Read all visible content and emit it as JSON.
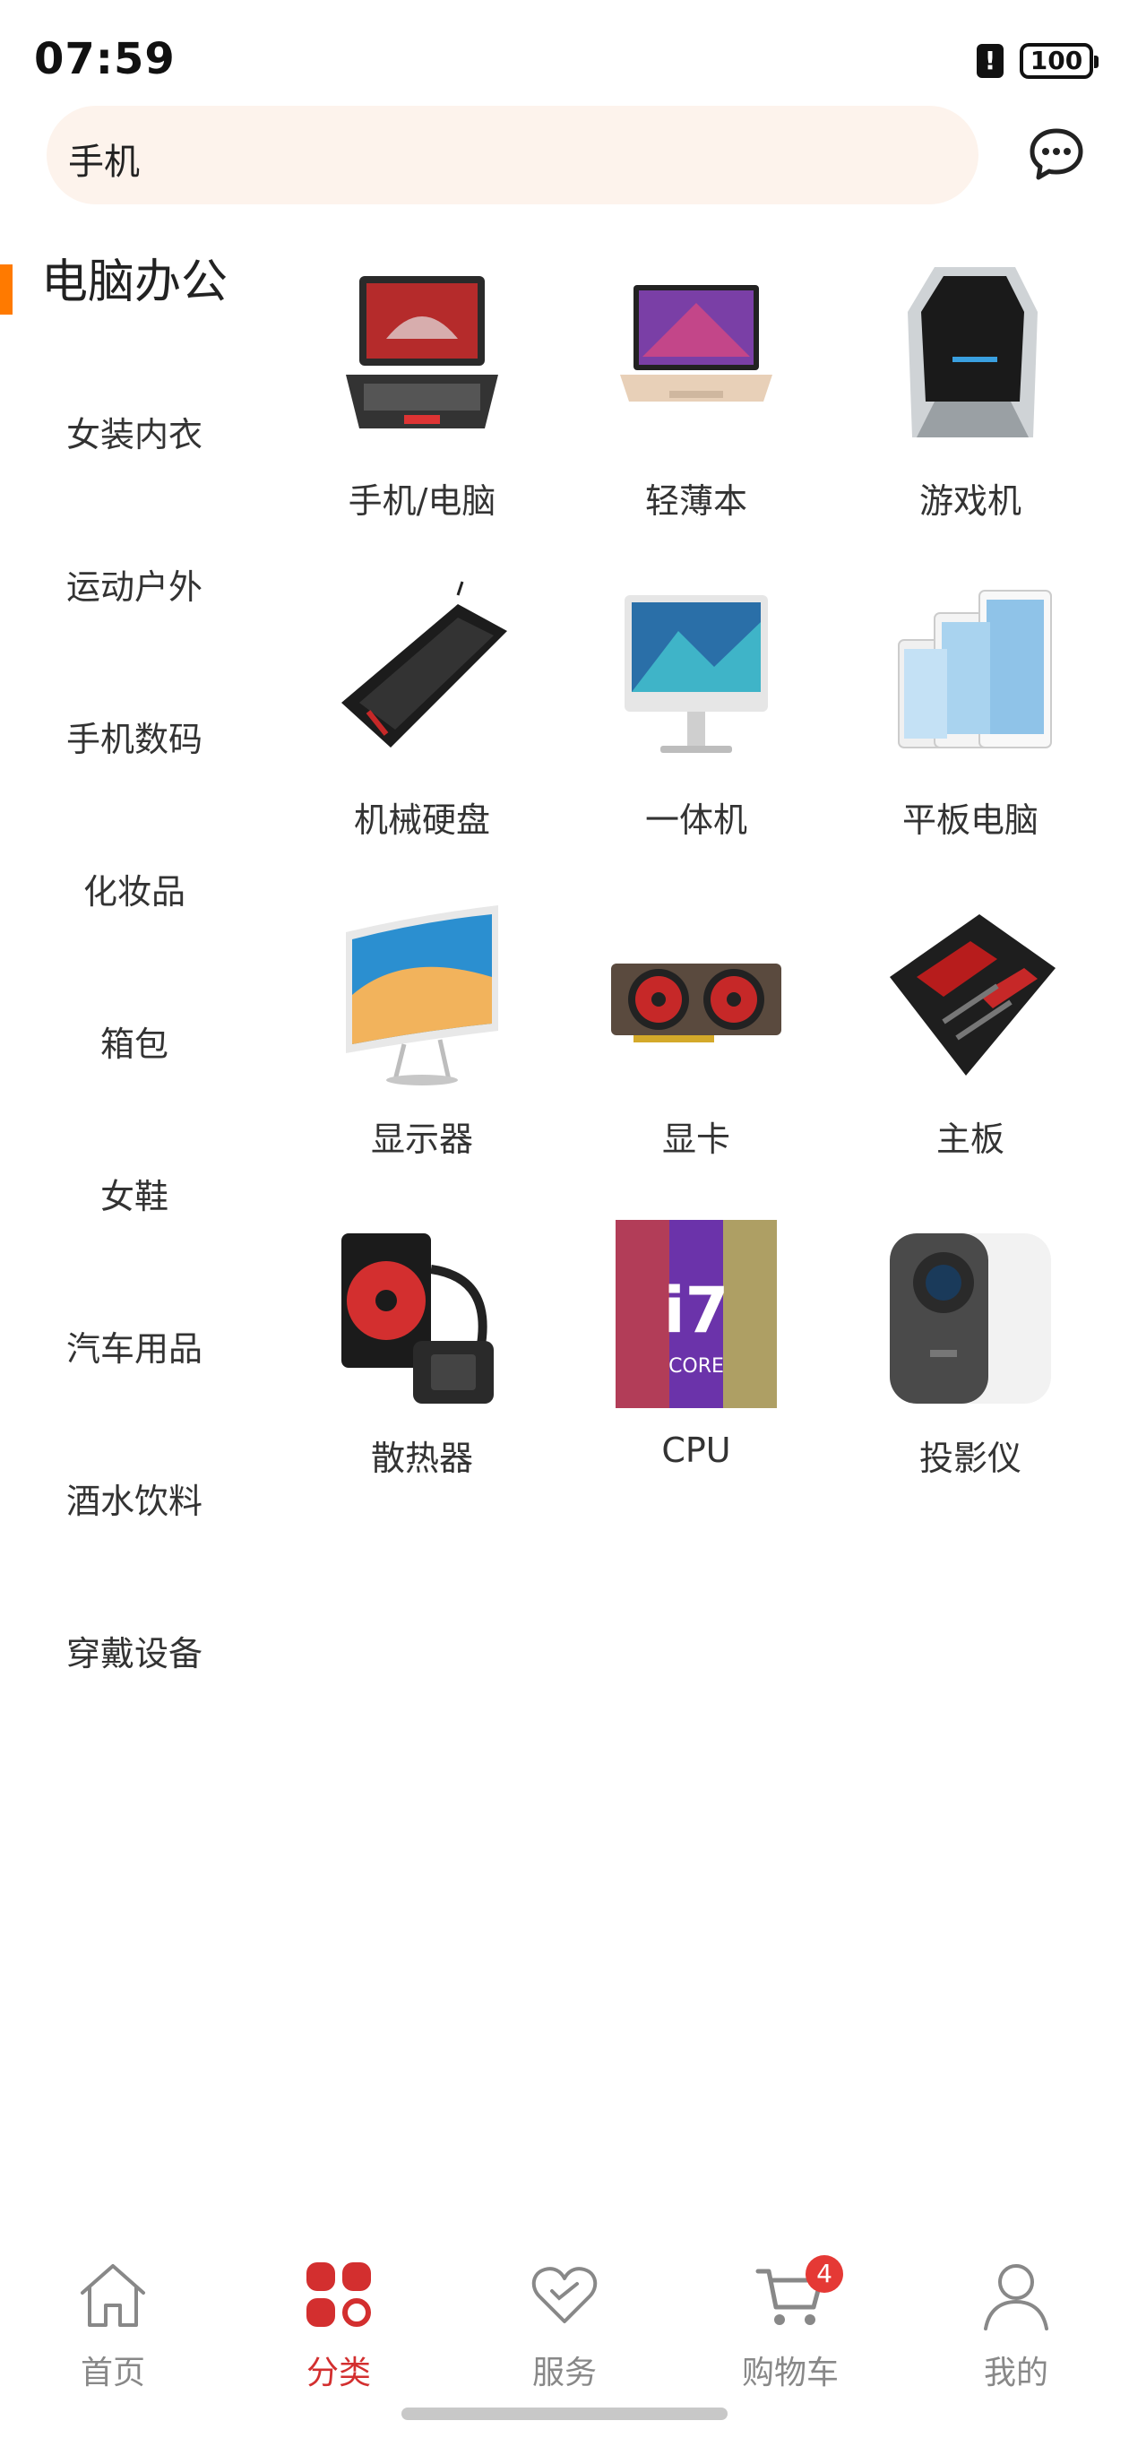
{
  "status_bar": {
    "time": "07:59",
    "battery": "100"
  },
  "search": {
    "value": "手机"
  },
  "sidebar": {
    "items": [
      {
        "label": "电脑办公",
        "active": true
      },
      {
        "label": "女装内衣"
      },
      {
        "label": "运动户外"
      },
      {
        "label": "手机数码"
      },
      {
        "label": "化妆品"
      },
      {
        "label": "箱包"
      },
      {
        "label": "女鞋"
      },
      {
        "label": "汽车用品"
      },
      {
        "label": "酒水饮料"
      },
      {
        "label": "穿戴设备"
      }
    ]
  },
  "products": [
    {
      "label": "手机/电脑",
      "icon": "laptop-image"
    },
    {
      "label": "轻薄本",
      "icon": "ultrabook-image"
    },
    {
      "label": "游戏机",
      "icon": "gaming-pc-image"
    },
    {
      "label": "机械硬盘",
      "icon": "keyboard-image"
    },
    {
      "label": "一体机",
      "icon": "all-in-one-image"
    },
    {
      "label": "平板电脑",
      "icon": "tablet-image"
    },
    {
      "label": "显示器",
      "icon": "monitor-image"
    },
    {
      "label": "显卡",
      "icon": "graphics-card-image"
    },
    {
      "label": "主板",
      "icon": "motherboard-image"
    },
    {
      "label": "散热器",
      "icon": "cooler-image"
    },
    {
      "label": "CPU",
      "icon": "cpu-image"
    },
    {
      "label": "投影仪",
      "icon": "projector-image"
    }
  ],
  "nav": {
    "items": [
      {
        "label": "首页",
        "icon": "home-icon"
      },
      {
        "label": "分类",
        "icon": "category-icon",
        "active": true
      },
      {
        "label": "服务",
        "icon": "heart-icon"
      },
      {
        "label": "购物车",
        "icon": "cart-icon",
        "badge": "4"
      },
      {
        "label": "我的",
        "icon": "profile-icon"
      }
    ]
  },
  "colors": {
    "accent": "#d32f2f",
    "sidebar_marker": "#ff7a00",
    "search_bg": "#fdf3ec"
  }
}
